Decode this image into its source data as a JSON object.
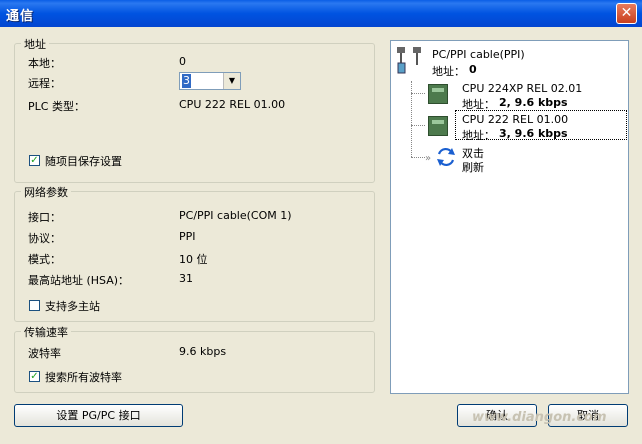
{
  "window": {
    "title": "通信",
    "close_glyph": "✕"
  },
  "address_group": {
    "title": "地址",
    "local_label": "本地：",
    "local_value": "0",
    "remote_label": "远程：",
    "remote_value": "3",
    "plc_type_label": "PLC 类型：",
    "plc_type_value": "CPU 222 REL 01.00",
    "save_with_project_label": "随项目保存设置",
    "save_with_project_checked": true
  },
  "network_group": {
    "title": "网络参数",
    "interface_label": "接口：",
    "interface_value": "PC/PPI cable(COM 1)",
    "protocol_label": "协议：",
    "protocol_value": "PPI",
    "mode_label": "模式：",
    "mode_value": "10 位",
    "hsa_label": "最高站地址 (HSA)：",
    "hsa_value": "31",
    "multi_master_label": "支持多主站",
    "multi_master_checked": false
  },
  "baud_group": {
    "title": "传输速率",
    "baud_label": "波特率",
    "baud_value": "9.6 kbps",
    "search_all_label": "搜索所有波特率",
    "search_all_checked": true
  },
  "buttons": {
    "set_pgpc": "设置 PG/PC 接口",
    "ok": "确认",
    "cancel": "取消"
  },
  "tree": {
    "cable_name": "PC/PPI cable(PPI)",
    "cable_addr_label": "地址：",
    "cable_addr_value": "0",
    "devices": [
      {
        "name": "CPU 224XP REL 02.01",
        "addr_text": "地址：",
        "addr_value": "2, 9.6 kbps"
      },
      {
        "name": "CPU 222 REL 01.00",
        "addr_text": "地址：",
        "addr_value": "3, 9.6 kbps"
      }
    ],
    "refresh_line1": "双击",
    "refresh_line2": "刷新"
  },
  "watermark": "www.diangon.com"
}
